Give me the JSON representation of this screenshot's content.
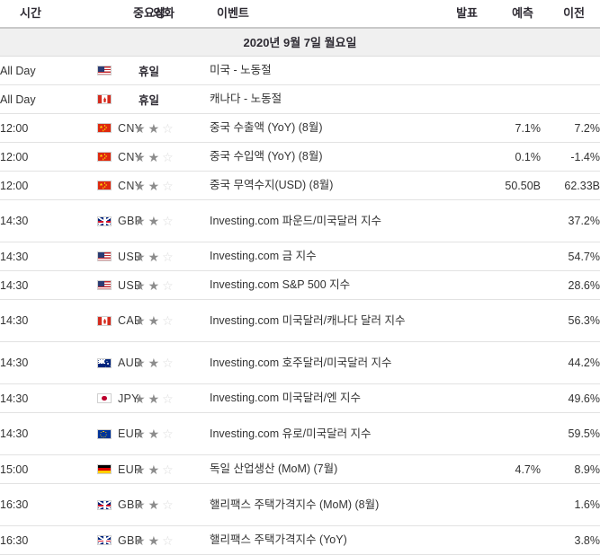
{
  "table": {
    "columns": [
      {
        "key": "time",
        "label": "시간"
      },
      {
        "key": "currency",
        "label": "외화"
      },
      {
        "key": "impact",
        "label": "중요성"
      },
      {
        "key": "event",
        "label": "이벤트"
      },
      {
        "key": "actual",
        "label": "발표"
      },
      {
        "key": "forecast",
        "label": "예측"
      },
      {
        "key": "previous",
        "label": "이전"
      }
    ],
    "date_header": "2020년 9월 7일 월요일",
    "rows": [
      {
        "time": "All Day",
        "flag": "us-flag-icon",
        "currency": "",
        "stars": 0,
        "holiday_label": "휴일",
        "event": "미국 - 노동절",
        "actual": "",
        "forecast": "",
        "previous": "",
        "tall": false
      },
      {
        "time": "All Day",
        "flag": "ca-flag-icon",
        "currency": "",
        "stars": 0,
        "holiday_label": "휴일",
        "event": "캐나다 - 노동절",
        "actual": "",
        "forecast": "",
        "previous": "",
        "tall": false
      },
      {
        "time": "12:00",
        "flag": "cn-flag-icon",
        "currency": "CNY",
        "stars": 2,
        "holiday_label": "",
        "event": "중국 수출액 (YoY) (8월)",
        "actual": "",
        "forecast": "7.1%",
        "previous": "7.2%",
        "tall": false
      },
      {
        "time": "12:00",
        "flag": "cn-flag-icon",
        "currency": "CNY",
        "stars": 2,
        "holiday_label": "",
        "event": "중국 수입액 (YoY) (8월)",
        "actual": "",
        "forecast": "0.1%",
        "previous": "-1.4%",
        "tall": false
      },
      {
        "time": "12:00",
        "flag": "cn-flag-icon",
        "currency": "CNY",
        "stars": 2,
        "holiday_label": "",
        "event": "중국 무역수지(USD) (8월)",
        "actual": "",
        "forecast": "50.50B",
        "previous": "62.33B",
        "tall": false
      },
      {
        "time": "14:30",
        "flag": "gb-flag-icon",
        "currency": "GBP",
        "stars": 2,
        "holiday_label": "",
        "event": "Investing.com 파운드/미국달러 지수",
        "actual": "",
        "forecast": "",
        "previous": "37.2%",
        "tall": true
      },
      {
        "time": "14:30",
        "flag": "us-flag-icon",
        "currency": "USD",
        "stars": 2,
        "holiday_label": "",
        "event": "Investing.com 금 지수",
        "actual": "",
        "forecast": "",
        "previous": "54.7%",
        "tall": false
      },
      {
        "time": "14:30",
        "flag": "us-flag-icon",
        "currency": "USD",
        "stars": 2,
        "holiday_label": "",
        "event": "Investing.com S&P 500 지수",
        "actual": "",
        "forecast": "",
        "previous": "28.6%",
        "tall": false
      },
      {
        "time": "14:30",
        "flag": "ca-flag-icon",
        "currency": "CAD",
        "stars": 2,
        "holiday_label": "",
        "event": "Investing.com 미국달러/캐나다 달러 지수",
        "actual": "",
        "forecast": "",
        "previous": "56.3%",
        "tall": true
      },
      {
        "time": "14:30",
        "flag": "au-flag-icon",
        "currency": "AUD",
        "stars": 2,
        "holiday_label": "",
        "event": "Investing.com 호주달러/미국달러 지수",
        "actual": "",
        "forecast": "",
        "previous": "44.2%",
        "tall": true
      },
      {
        "time": "14:30",
        "flag": "jp-flag-icon",
        "currency": "JPY",
        "stars": 2,
        "holiday_label": "",
        "event": "Investing.com 미국달러/엔 지수",
        "actual": "",
        "forecast": "",
        "previous": "49.6%",
        "tall": false
      },
      {
        "time": "14:30",
        "flag": "eu-flag-icon",
        "currency": "EUR",
        "stars": 2,
        "holiday_label": "",
        "event": "Investing.com 유로/미국달러 지수",
        "actual": "",
        "forecast": "",
        "previous": "59.5%",
        "tall": true
      },
      {
        "time": "15:00",
        "flag": "de-flag-icon",
        "currency": "EUR",
        "stars": 2,
        "holiday_label": "",
        "event": "독일 산업생산 (MoM) (7월)",
        "actual": "",
        "forecast": "4.7%",
        "previous": "8.9%",
        "tall": false
      },
      {
        "time": "16:30",
        "flag": "gb-flag-icon",
        "currency": "GBP",
        "stars": 2,
        "holiday_label": "",
        "event": "핼리팩스 주택가격지수 (MoM) (8월)",
        "actual": "",
        "forecast": "",
        "previous": "1.6%",
        "tall": true
      },
      {
        "time": "16:30",
        "flag": "gb-flag-icon",
        "currency": "GBP",
        "stars": 2,
        "holiday_label": "",
        "event": "핼리팩스 주택가격지수 (YoY)",
        "actual": "",
        "forecast": "",
        "previous": "3.8%",
        "tall": false
      }
    ]
  },
  "icons": {
    "star_filled": "★",
    "star_empty": "☆"
  },
  "colors": {
    "header_text": "#2e2b33",
    "date_band_bg": "#f0f0f0",
    "row_border": "#e2e2e2",
    "star_on": "#8c8c8c",
    "star_off": "#dcdcdc"
  }
}
